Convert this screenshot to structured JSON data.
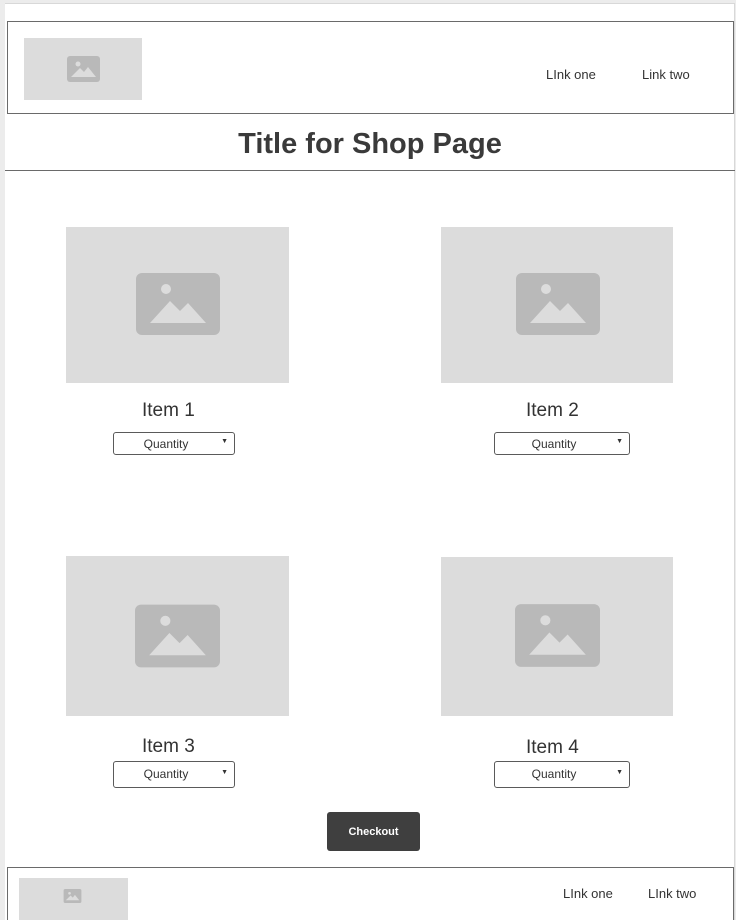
{
  "header": {
    "logo_icon": "image-placeholder-icon",
    "nav": [
      {
        "label": "LInk one"
      },
      {
        "label": "Link two"
      }
    ]
  },
  "main": {
    "title": "Title for Shop Page",
    "items": [
      {
        "name": "Item 1",
        "image_icon": "image-placeholder-icon",
        "quantity_label": "Quantity"
      },
      {
        "name": "Item 2",
        "image_icon": "image-placeholder-icon",
        "quantity_label": "Quantity"
      },
      {
        "name": "Item 3",
        "image_icon": "image-placeholder-icon",
        "quantity_label": "Quantity"
      },
      {
        "name": "Item 4",
        "image_icon": "image-placeholder-icon",
        "quantity_label": "Quantity"
      }
    ],
    "checkout_label": "Checkout"
  },
  "footer": {
    "logo_icon": "image-placeholder-icon",
    "nav": [
      {
        "label": "LInk one"
      },
      {
        "label": "LInk two"
      }
    ]
  },
  "colors": {
    "placeholder_bg": "#dcdcdc",
    "placeholder_icon": "#b9b9b9",
    "button_bg": "#3f3f3f",
    "border": "#6a6a6a"
  }
}
